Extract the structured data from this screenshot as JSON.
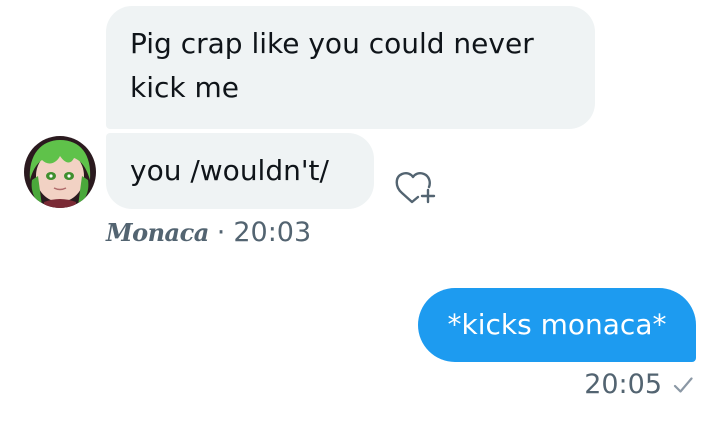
{
  "conversation": {
    "incoming": {
      "messages": [
        {
          "text": "Pig crap like you could never kick me"
        },
        {
          "text": "you /wouldn't/"
        }
      ],
      "sender_name": "Monaca",
      "separator": "·",
      "timestamp": "20:03",
      "avatar_icon": "avatar-anime-green-hair"
    },
    "outgoing": {
      "messages": [
        {
          "text": "*kicks monaca*"
        }
      ],
      "timestamp": "20:05",
      "status_icon": "check-icon"
    },
    "reaction_button_icon": "add-reaction-heart-icon"
  },
  "colors": {
    "incoming_bubble": "#eff3f4",
    "outgoing_bubble": "#1d9bf0",
    "meta_text": "#536471",
    "primary_text": "#0f1419"
  }
}
